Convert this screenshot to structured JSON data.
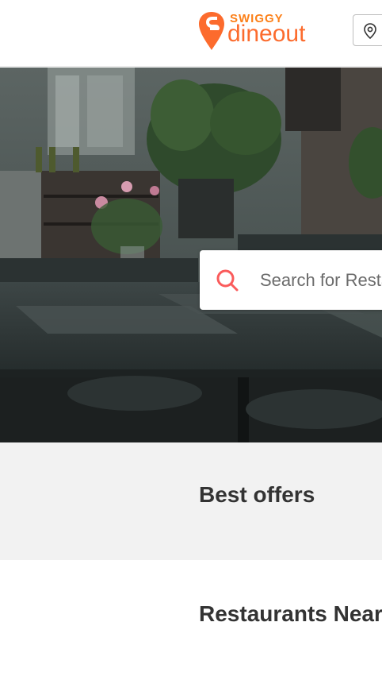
{
  "header": {
    "brand_top": "SWIGGY",
    "brand_bottom": "dineout",
    "location_icon": "location-pin-icon",
    "colors": {
      "brand": "#fc8019",
      "text_brand": "#fc6b2d"
    }
  },
  "hero": {
    "image_description_icon": "restaurant-interior-photo",
    "search": {
      "placeholder": "Search for Restaurants",
      "icon": "search-icon",
      "icon_color": "#fa5b5b"
    }
  },
  "sections": {
    "best_offers_title": "Best offers",
    "restaurants_near_title": "Restaurants Near"
  }
}
